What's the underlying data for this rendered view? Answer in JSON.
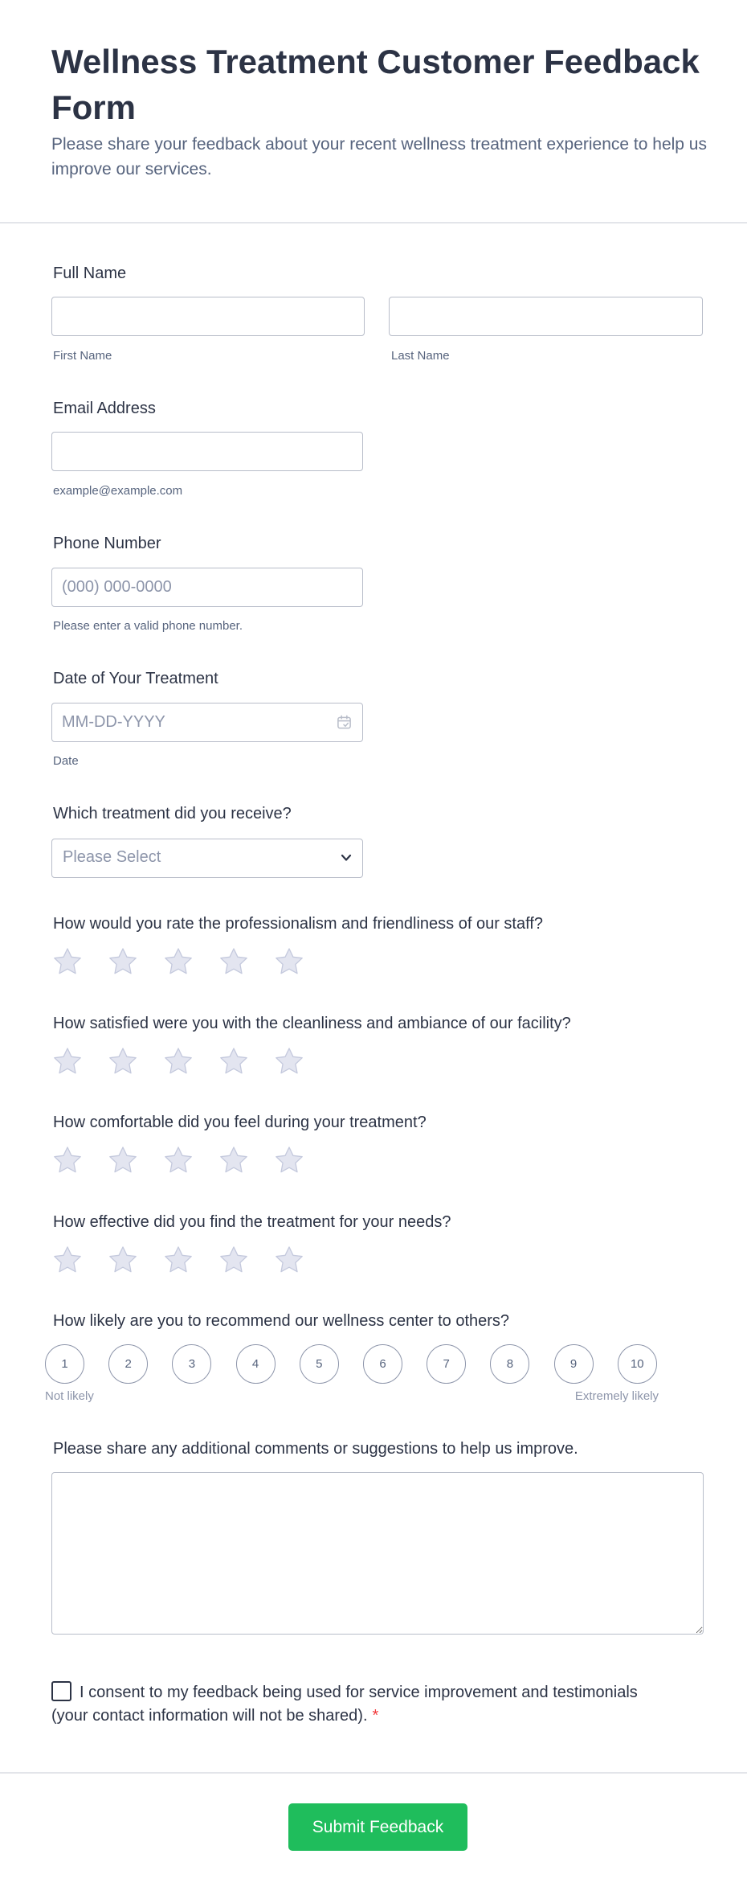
{
  "form": {
    "title": "Wellness Treatment Customer Feedback Form",
    "subtitle": "Please share your feedback about your recent wellness treatment experience to help us improve our services."
  },
  "full_name": {
    "label": "Full Name",
    "first_sublabel": "First Name",
    "last_sublabel": "Last Name",
    "first_value": "",
    "last_value": ""
  },
  "email": {
    "label": "Email Address",
    "sublabel": "example@example.com",
    "value": ""
  },
  "phone": {
    "label": "Phone Number",
    "placeholder": "(000) 000-0000",
    "sublabel": "Please enter a valid phone number."
  },
  "treatment_date": {
    "label": "Date of Your Treatment",
    "placeholder": "MM-DD-YYYY",
    "sublabel": "Date",
    "icon": "calendar-icon"
  },
  "treatment_type": {
    "label": "Which treatment did you receive?",
    "selected": "Please Select",
    "icon": "chevron-down-icon"
  },
  "ratings": {
    "staff": {
      "question": "How would you rate the professionalism and friendliness of our staff?",
      "value": 0,
      "max": 5
    },
    "facility": {
      "question": "How satisfied were you with the cleanliness and ambiance of our facility?",
      "value": 0,
      "max": 5
    },
    "comfort": {
      "question": "How comfortable did you feel during your treatment?",
      "value": 0,
      "max": 5
    },
    "effectiveness": {
      "question": "How effective did you find the treatment for your needs?",
      "value": 0,
      "max": 5
    }
  },
  "recommend": {
    "question": "How likely are you to recommend our wellness center to others?",
    "options": [
      "1",
      "2",
      "3",
      "4",
      "5",
      "6",
      "7",
      "8",
      "9",
      "10"
    ],
    "low_label": "Not likely",
    "high_label": "Extremely likely"
  },
  "comments": {
    "label": "Please share any additional comments or suggestions to help us improve.",
    "value": ""
  },
  "consent": {
    "text": "I consent to my feedback being used for service improvement and testimonials (your contact information will not be shared).",
    "required_mark": "*",
    "checked": false
  },
  "submit": {
    "label": "Submit Feedback"
  },
  "colors": {
    "text": "#2c3345",
    "muted": "#57647e",
    "border": "#b8bdc9",
    "star_empty": "#e3e5f0",
    "star_stroke": "#c4c9dd",
    "submit": "#1fbd5c",
    "required": "#f23a3c"
  }
}
